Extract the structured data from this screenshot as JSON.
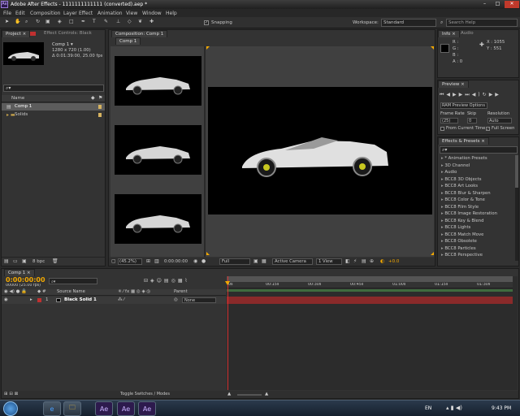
{
  "window": {
    "title": "Adobe After Effects - 1111111111111 (converted).aep *",
    "controls": [
      "–",
      "□",
      "✕"
    ]
  },
  "menu": [
    "File",
    "Edit",
    "Composition",
    "Layer",
    "Effect",
    "Animation",
    "View",
    "Window",
    "Help"
  ],
  "toolbar": {
    "snapping": "Snapping",
    "workspace_label": "Workspace:",
    "workspace_value": "Standard",
    "search_placeholder": "Search Help"
  },
  "project": {
    "tab_project": "Project ×",
    "tab_effect_controls": "Effect Controls: Black",
    "thumb_name": "Comp 1 ▾",
    "thumb_size": "1280 x 720 (1.00)",
    "thumb_duration": "Δ 0:01:39:00, 25.00 fps",
    "search_placeholder": "",
    "col_name": "Name",
    "items": [
      {
        "name": "Comp 1",
        "selected": true
      },
      {
        "name": "Solids",
        "selected": false
      }
    ],
    "bpc": "8 bpc"
  },
  "composition": {
    "tab": "Composition: Comp 1",
    "subtab": "Comp 1",
    "zoom": "(45.2%)",
    "timecode": "0:00:00:00",
    "resolution": "Full",
    "camera": "Active Camera",
    "views": "1 View",
    "exposure": "+0.0"
  },
  "info": {
    "tab_info": "Info ×",
    "tab_audio": "Audio",
    "r": "R :",
    "g": "G :",
    "b": "B :",
    "a": "A : 0",
    "x": "X : 1055",
    "y": "Y : 551"
  },
  "preview": {
    "tab": "Preview ×",
    "ram_options": "RAM Preview Options",
    "frame_rate_label": "Frame Rate",
    "skip_label": "Skip",
    "resolution_label": "Resolution",
    "frame_rate": "(25)",
    "skip": "0",
    "resolution": "Auto",
    "from_current": "From Current Time",
    "full_screen": "Full Screen"
  },
  "effects": {
    "tab": "Effects & Presets ×",
    "items": [
      "* Animation Presets",
      "3D Channel",
      "Audio",
      "BCC8 3D Objects",
      "BCC8 Art Looks",
      "BCC8 Blur & Sharpen",
      "BCC8 Color & Tone",
      "BCC8 Film Style",
      "BCC8 Image Restoration",
      "BCC8 Key & Blend",
      "BCC8 Lights",
      "BCC8 Match Move",
      "BCC8 Obsolete",
      "BCC8 Particles",
      "BCC8 Perspective"
    ]
  },
  "timeline": {
    "tab": "Comp 1 ×",
    "timecode": "0:00:00:00",
    "frames": "00000 (25.00 fps)",
    "col_source": "Source Name",
    "col_parent": "Parent",
    "layer_num": "1",
    "layer_name": "Black Solid 1",
    "parent_value": "None",
    "ruler": [
      "0s",
      "00:15s",
      "00:30s",
      "00:45s",
      "01:00s",
      "01:15s",
      "01:30s"
    ],
    "toggle_label": "Toggle Switches / Modes"
  },
  "taskbar": {
    "lang": "EN",
    "time": "9:43 PM",
    "apps": [
      "e",
      "🗀",
      "Ae",
      "Ae",
      "Ae"
    ]
  },
  "colors": {
    "accent": "#f2a800",
    "layer_bar": "#8a2a2a",
    "playhead": "#d03030"
  }
}
